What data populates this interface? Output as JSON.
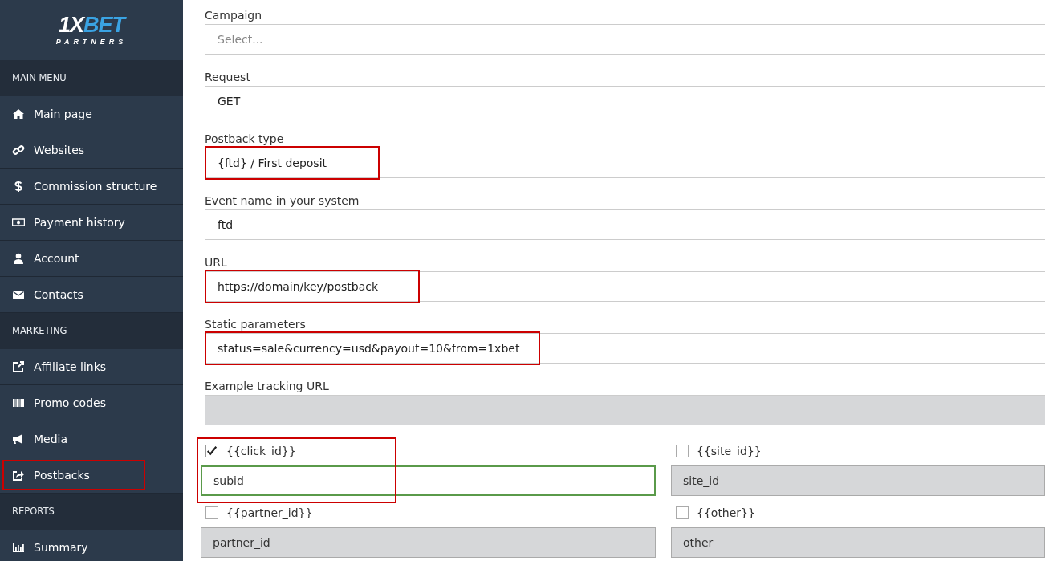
{
  "logo": {
    "primary": "1X",
    "accent": "BET",
    "subtitle": "PARTNERS"
  },
  "sidebar": {
    "sections": [
      {
        "title": "MAIN MENU",
        "items": [
          {
            "label": "Main page",
            "highlighted": false
          },
          {
            "label": "Websites",
            "highlighted": false
          },
          {
            "label": "Commission structure",
            "highlighted": false
          },
          {
            "label": "Payment history",
            "highlighted": false
          },
          {
            "label": "Account",
            "highlighted": false
          },
          {
            "label": "Contacts",
            "highlighted": false
          }
        ]
      },
      {
        "title": "MARKETING",
        "items": [
          {
            "label": "Affiliate links",
            "highlighted": false
          },
          {
            "label": "Promo codes",
            "highlighted": false
          },
          {
            "label": "Media",
            "highlighted": false
          },
          {
            "label": "Postbacks",
            "highlighted": true
          }
        ]
      },
      {
        "title": "REPORTS",
        "items": [
          {
            "label": "Summary",
            "highlighted": false
          }
        ]
      }
    ]
  },
  "form": {
    "fields": [
      {
        "label": "Campaign",
        "placeholder": "Select...",
        "disabled": false,
        "highlighted": false
      },
      {
        "label": "Request",
        "value": "GET",
        "disabled": false,
        "highlighted": false
      },
      {
        "label": "Postback type",
        "value": "{ftd} / First deposit",
        "disabled": false,
        "highlighted": true
      },
      {
        "label": "Event name in your system",
        "value": "ftd",
        "disabled": false,
        "highlighted": false
      },
      {
        "label": "URL",
        "value": "https://domain/key/postback",
        "disabled": false,
        "highlighted": true
      },
      {
        "label": "Static parameters",
        "value": "status=sale&currency=usd&payout=10&from=1xbet",
        "disabled": false,
        "highlighted": true
      },
      {
        "label": "Example tracking URL",
        "disabled": true,
        "highlighted": false
      }
    ],
    "parameters": [
      {
        "label": "{{click_id}}",
        "value": "subid",
        "checked": true,
        "highlighted": true
      },
      {
        "label": "{{site_id}}",
        "value": "site_id",
        "checked": false,
        "highlighted": false
      },
      {
        "label": "{{partner_id}}",
        "value": "partner_id",
        "checked": false,
        "highlighted": false
      },
      {
        "label": "{{other}}",
        "value": "other",
        "checked": false,
        "highlighted": false
      }
    ]
  }
}
